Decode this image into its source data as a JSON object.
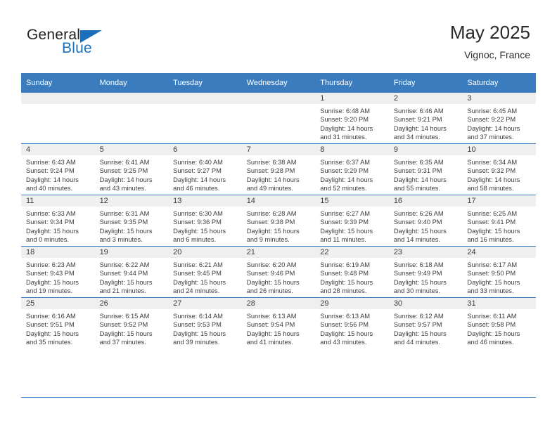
{
  "brand": {
    "name_primary": "General",
    "name_secondary": "Blue",
    "accent_color": "#1c6fba"
  },
  "header": {
    "title": "May 2025",
    "subtitle": "Vignoc, France"
  },
  "calendar": {
    "header_color": "#3a7cbe",
    "weekday_headers": [
      "Sunday",
      "Monday",
      "Tuesday",
      "Wednesday",
      "Thursday",
      "Friday",
      "Saturday"
    ],
    "weeks": [
      [
        {
          "day": "",
          "sunrise": "",
          "sunset": "",
          "daylight_line1": "",
          "daylight_line2": ""
        },
        {
          "day": "",
          "sunrise": "",
          "sunset": "",
          "daylight_line1": "",
          "daylight_line2": ""
        },
        {
          "day": "",
          "sunrise": "",
          "sunset": "",
          "daylight_line1": "",
          "daylight_line2": ""
        },
        {
          "day": "",
          "sunrise": "",
          "sunset": "",
          "daylight_line1": "",
          "daylight_line2": ""
        },
        {
          "day": "1",
          "sunrise": "Sunrise: 6:48 AM",
          "sunset": "Sunset: 9:20 PM",
          "daylight_line1": "Daylight: 14 hours",
          "daylight_line2": "and 31 minutes."
        },
        {
          "day": "2",
          "sunrise": "Sunrise: 6:46 AM",
          "sunset": "Sunset: 9:21 PM",
          "daylight_line1": "Daylight: 14 hours",
          "daylight_line2": "and 34 minutes."
        },
        {
          "day": "3",
          "sunrise": "Sunrise: 6:45 AM",
          "sunset": "Sunset: 9:22 PM",
          "daylight_line1": "Daylight: 14 hours",
          "daylight_line2": "and 37 minutes."
        }
      ],
      [
        {
          "day": "4",
          "sunrise": "Sunrise: 6:43 AM",
          "sunset": "Sunset: 9:24 PM",
          "daylight_line1": "Daylight: 14 hours",
          "daylight_line2": "and 40 minutes."
        },
        {
          "day": "5",
          "sunrise": "Sunrise: 6:41 AM",
          "sunset": "Sunset: 9:25 PM",
          "daylight_line1": "Daylight: 14 hours",
          "daylight_line2": "and 43 minutes."
        },
        {
          "day": "6",
          "sunrise": "Sunrise: 6:40 AM",
          "sunset": "Sunset: 9:27 PM",
          "daylight_line1": "Daylight: 14 hours",
          "daylight_line2": "and 46 minutes."
        },
        {
          "day": "7",
          "sunrise": "Sunrise: 6:38 AM",
          "sunset": "Sunset: 9:28 PM",
          "daylight_line1": "Daylight: 14 hours",
          "daylight_line2": "and 49 minutes."
        },
        {
          "day": "8",
          "sunrise": "Sunrise: 6:37 AM",
          "sunset": "Sunset: 9:29 PM",
          "daylight_line1": "Daylight: 14 hours",
          "daylight_line2": "and 52 minutes."
        },
        {
          "day": "9",
          "sunrise": "Sunrise: 6:35 AM",
          "sunset": "Sunset: 9:31 PM",
          "daylight_line1": "Daylight: 14 hours",
          "daylight_line2": "and 55 minutes."
        },
        {
          "day": "10",
          "sunrise": "Sunrise: 6:34 AM",
          "sunset": "Sunset: 9:32 PM",
          "daylight_line1": "Daylight: 14 hours",
          "daylight_line2": "and 58 minutes."
        }
      ],
      [
        {
          "day": "11",
          "sunrise": "Sunrise: 6:33 AM",
          "sunset": "Sunset: 9:34 PM",
          "daylight_line1": "Daylight: 15 hours",
          "daylight_line2": "and 0 minutes."
        },
        {
          "day": "12",
          "sunrise": "Sunrise: 6:31 AM",
          "sunset": "Sunset: 9:35 PM",
          "daylight_line1": "Daylight: 15 hours",
          "daylight_line2": "and 3 minutes."
        },
        {
          "day": "13",
          "sunrise": "Sunrise: 6:30 AM",
          "sunset": "Sunset: 9:36 PM",
          "daylight_line1": "Daylight: 15 hours",
          "daylight_line2": "and 6 minutes."
        },
        {
          "day": "14",
          "sunrise": "Sunrise: 6:28 AM",
          "sunset": "Sunset: 9:38 PM",
          "daylight_line1": "Daylight: 15 hours",
          "daylight_line2": "and 9 minutes."
        },
        {
          "day": "15",
          "sunrise": "Sunrise: 6:27 AM",
          "sunset": "Sunset: 9:39 PM",
          "daylight_line1": "Daylight: 15 hours",
          "daylight_line2": "and 11 minutes."
        },
        {
          "day": "16",
          "sunrise": "Sunrise: 6:26 AM",
          "sunset": "Sunset: 9:40 PM",
          "daylight_line1": "Daylight: 15 hours",
          "daylight_line2": "and 14 minutes."
        },
        {
          "day": "17",
          "sunrise": "Sunrise: 6:25 AM",
          "sunset": "Sunset: 9:41 PM",
          "daylight_line1": "Daylight: 15 hours",
          "daylight_line2": "and 16 minutes."
        }
      ],
      [
        {
          "day": "18",
          "sunrise": "Sunrise: 6:23 AM",
          "sunset": "Sunset: 9:43 PM",
          "daylight_line1": "Daylight: 15 hours",
          "daylight_line2": "and 19 minutes."
        },
        {
          "day": "19",
          "sunrise": "Sunrise: 6:22 AM",
          "sunset": "Sunset: 9:44 PM",
          "daylight_line1": "Daylight: 15 hours",
          "daylight_line2": "and 21 minutes."
        },
        {
          "day": "20",
          "sunrise": "Sunrise: 6:21 AM",
          "sunset": "Sunset: 9:45 PM",
          "daylight_line1": "Daylight: 15 hours",
          "daylight_line2": "and 24 minutes."
        },
        {
          "day": "21",
          "sunrise": "Sunrise: 6:20 AM",
          "sunset": "Sunset: 9:46 PM",
          "daylight_line1": "Daylight: 15 hours",
          "daylight_line2": "and 26 minutes."
        },
        {
          "day": "22",
          "sunrise": "Sunrise: 6:19 AM",
          "sunset": "Sunset: 9:48 PM",
          "daylight_line1": "Daylight: 15 hours",
          "daylight_line2": "and 28 minutes."
        },
        {
          "day": "23",
          "sunrise": "Sunrise: 6:18 AM",
          "sunset": "Sunset: 9:49 PM",
          "daylight_line1": "Daylight: 15 hours",
          "daylight_line2": "and 30 minutes."
        },
        {
          "day": "24",
          "sunrise": "Sunrise: 6:17 AM",
          "sunset": "Sunset: 9:50 PM",
          "daylight_line1": "Daylight: 15 hours",
          "daylight_line2": "and 33 minutes."
        }
      ],
      [
        {
          "day": "25",
          "sunrise": "Sunrise: 6:16 AM",
          "sunset": "Sunset: 9:51 PM",
          "daylight_line1": "Daylight: 15 hours",
          "daylight_line2": "and 35 minutes."
        },
        {
          "day": "26",
          "sunrise": "Sunrise: 6:15 AM",
          "sunset": "Sunset: 9:52 PM",
          "daylight_line1": "Daylight: 15 hours",
          "daylight_line2": "and 37 minutes."
        },
        {
          "day": "27",
          "sunrise": "Sunrise: 6:14 AM",
          "sunset": "Sunset: 9:53 PM",
          "daylight_line1": "Daylight: 15 hours",
          "daylight_line2": "and 39 minutes."
        },
        {
          "day": "28",
          "sunrise": "Sunrise: 6:13 AM",
          "sunset": "Sunset: 9:54 PM",
          "daylight_line1": "Daylight: 15 hours",
          "daylight_line2": "and 41 minutes."
        },
        {
          "day": "29",
          "sunrise": "Sunrise: 6:13 AM",
          "sunset": "Sunset: 9:56 PM",
          "daylight_line1": "Daylight: 15 hours",
          "daylight_line2": "and 43 minutes."
        },
        {
          "day": "30",
          "sunrise": "Sunrise: 6:12 AM",
          "sunset": "Sunset: 9:57 PM",
          "daylight_line1": "Daylight: 15 hours",
          "daylight_line2": "and 44 minutes."
        },
        {
          "day": "31",
          "sunrise": "Sunrise: 6:11 AM",
          "sunset": "Sunset: 9:58 PM",
          "daylight_line1": "Daylight: 15 hours",
          "daylight_line2": "and 46 minutes."
        }
      ]
    ]
  }
}
